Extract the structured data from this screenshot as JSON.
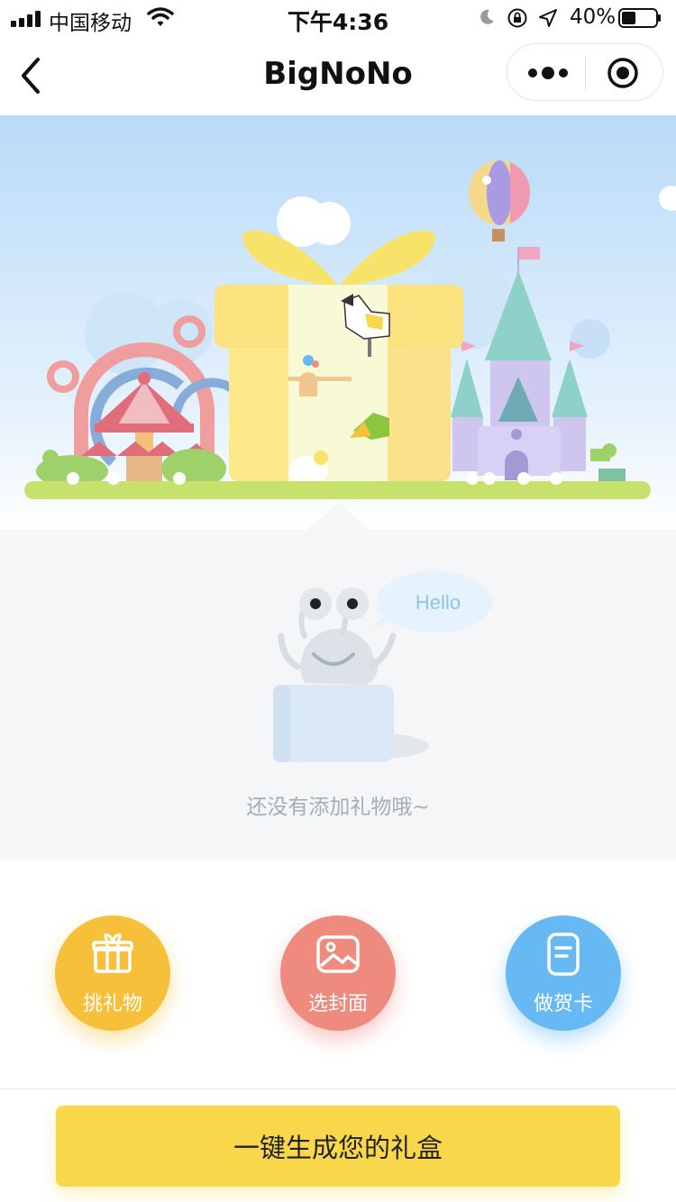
{
  "status_bar": {
    "carrier": "中国移动",
    "time": "下午4:36",
    "battery": "40%",
    "icons": [
      "signal-icon",
      "wifi-icon",
      "moon-icon",
      "rotation-lock-icon",
      "location-arrow-icon",
      "battery-icon"
    ]
  },
  "nav": {
    "title": "BigNoNo",
    "back_icon": "chevron-left-icon",
    "more_icon": "more-dots-icon",
    "close_icon": "target-close-icon"
  },
  "banner": {
    "bubble_text": "Hello"
  },
  "empty_state": {
    "text": "还没有添加礼物哦~"
  },
  "actions": [
    {
      "label": "挑礼物",
      "icon": "gift-icon",
      "color": "#f6c03b"
    },
    {
      "label": "选封面",
      "icon": "image-icon",
      "color": "#ef8a7f"
    },
    {
      "label": "做贺卡",
      "icon": "card-icon",
      "color": "#66b9f2"
    }
  ],
  "bottom": {
    "generate_label": "一键生成您的礼盒",
    "button_color": "#f8d84a"
  }
}
